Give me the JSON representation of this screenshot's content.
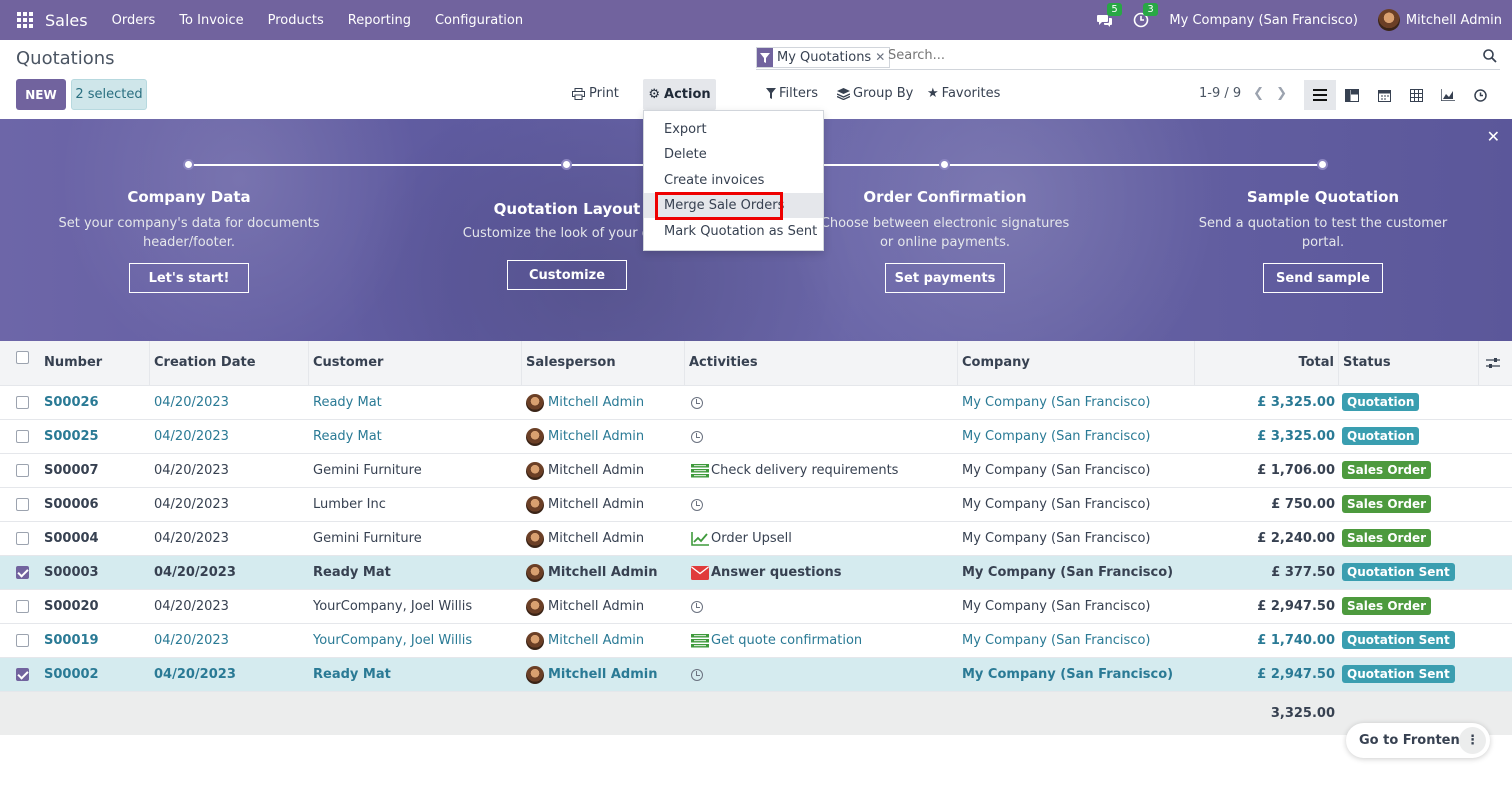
{
  "nav": {
    "app_name": "Sales",
    "menu": [
      "Orders",
      "To Invoice",
      "Products",
      "Reporting",
      "Configuration"
    ],
    "messages_count": "5",
    "activities_count": "3",
    "company": "My Company (San Francisco)",
    "user": "Mitchell Admin"
  },
  "control": {
    "title": "Quotations",
    "new_label": "NEW",
    "selected_label": "2 selected",
    "print_label": "Print",
    "action_label": "Action",
    "filters_label": "Filters",
    "groupby_label": "Group By",
    "favorites_label": "Favorites",
    "pager": "1-9 / 9",
    "search_facet": "My Quotations",
    "search_placeholder": "Search..."
  },
  "action_menu": {
    "items": [
      "Export",
      "Delete",
      "Create invoices",
      "Merge Sale Orders",
      "Mark Quotation as Sent"
    ],
    "highlighted": "Merge Sale Orders"
  },
  "onboarding": {
    "steps": [
      {
        "title": "Company Data",
        "desc1": "Set your company's data for documents",
        "desc2": "header/footer.",
        "button": "Let's start!"
      },
      {
        "title": "Quotation Layout",
        "desc1": "Customize the look of your quot",
        "desc2": "",
        "button": "Customize"
      },
      {
        "title": "Order Confirmation",
        "desc1": "Choose between electronic signatures",
        "desc2": "or online payments.",
        "button": "Set payments"
      },
      {
        "title": "Sample Quotation",
        "desc1": "Send a quotation to test the customer",
        "desc2": "portal.",
        "button": "Send sample"
      }
    ]
  },
  "table": {
    "headers": {
      "number": "Number",
      "date": "Creation Date",
      "customer": "Customer",
      "salesperson": "Salesperson",
      "activities": "Activities",
      "company": "Company",
      "total": "Total",
      "status": "Status"
    },
    "rows": [
      {
        "number": "S00026",
        "date": "04/20/2023",
        "customer": "Ready Mat",
        "salesperson": "Mitchell Admin",
        "activity": "",
        "company": "My Company (San Francisco)",
        "total": "£ 3,325.00",
        "status": "Quotation"
      },
      {
        "number": "S00025",
        "date": "04/20/2023",
        "customer": "Ready Mat",
        "salesperson": "Mitchell Admin",
        "activity": "",
        "company": "My Company (San Francisco)",
        "total": "£ 3,325.00",
        "status": "Quotation"
      },
      {
        "number": "S00007",
        "date": "04/20/2023",
        "customer": "Gemini Furniture",
        "salesperson": "Mitchell Admin",
        "activity": "Check delivery requirements",
        "company": "My Company (San Francisco)",
        "total": "£ 1,706.00",
        "status": "Sales Order"
      },
      {
        "number": "S00006",
        "date": "04/20/2023",
        "customer": "Lumber Inc",
        "salesperson": "Mitchell Admin",
        "activity": "",
        "company": "My Company (San Francisco)",
        "total": "£ 750.00",
        "status": "Sales Order"
      },
      {
        "number": "S00004",
        "date": "04/20/2023",
        "customer": "Gemini Furniture",
        "salesperson": "Mitchell Admin",
        "activity": "Order Upsell",
        "company": "My Company (San Francisco)",
        "total": "£ 2,240.00",
        "status": "Sales Order"
      },
      {
        "number": "S00003",
        "date": "04/20/2023",
        "customer": "Ready Mat",
        "salesperson": "Mitchell Admin",
        "activity": "Answer questions",
        "company": "My Company (San Francisco)",
        "total": "£ 377.50",
        "status": "Quotation Sent"
      },
      {
        "number": "S00020",
        "date": "04/20/2023",
        "customer": "YourCompany, Joel Willis",
        "salesperson": "Mitchell Admin",
        "activity": "",
        "company": "My Company (San Francisco)",
        "total": "£ 2,947.50",
        "status": "Sales Order"
      },
      {
        "number": "S00019",
        "date": "04/20/2023",
        "customer": "YourCompany, Joel Willis",
        "salesperson": "Mitchell Admin",
        "activity": "Get quote confirmation",
        "company": "My Company (San Francisco)",
        "total": "£ 1,740.00",
        "status": "Quotation Sent"
      },
      {
        "number": "S00002",
        "date": "04/20/2023",
        "customer": "Ready Mat",
        "salesperson": "Mitchell Admin",
        "activity": "",
        "company": "My Company (San Francisco)",
        "total": "£ 2,947.50",
        "status": "Quotation Sent"
      }
    ],
    "footer_total": "3,325.00"
  },
  "goto_frontend": "Go to Frontend"
}
